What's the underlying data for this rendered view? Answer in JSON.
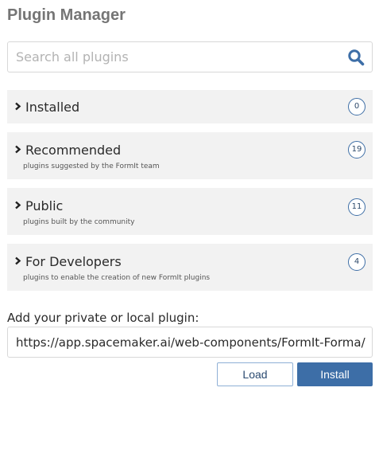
{
  "header": {
    "title": "Plugin Manager"
  },
  "search": {
    "placeholder": "Search all plugins",
    "value": "",
    "icon": "search-icon"
  },
  "sections": [
    {
      "label": "Installed",
      "subtitle": "",
      "count": "0",
      "icon": "chevron-right-icon"
    },
    {
      "label": "Recommended",
      "subtitle": "plugins suggested by the FormIt team",
      "count": "19",
      "icon": "chevron-right-icon"
    },
    {
      "label": "Public",
      "subtitle": "plugins built by the community",
      "count": "11",
      "icon": "chevron-right-icon"
    },
    {
      "label": "For Developers",
      "subtitle": "plugins to enable the creation of new FormIt plugins",
      "count": "4",
      "icon": "chevron-right-icon"
    }
  ],
  "custom_plugin": {
    "label": "Add your private or local plugin:",
    "url_value": "https://app.spacemaker.ai/web-components/FormIt-Forma/",
    "load_label": "Load",
    "install_label": "Install"
  },
  "colors": {
    "accent": "#3d6ea7",
    "section_bg": "#f2f2f2",
    "title": "#757575"
  }
}
